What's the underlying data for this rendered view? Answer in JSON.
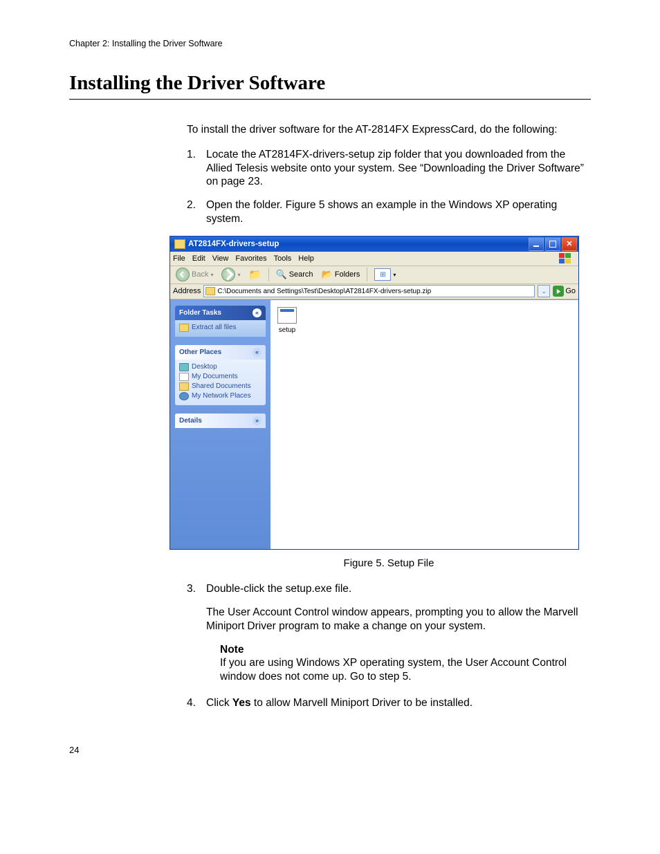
{
  "running_header": "Chapter 2: Installing the Driver Software",
  "heading": "Installing the Driver Software",
  "intro": "To install the driver software for the AT-2814FX ExpressCard, do the following:",
  "steps": {
    "s1_num": "1.",
    "s1": "Locate the AT2814FX-drivers-setup zip folder that you downloaded from the Allied Telesis website onto your system. See “Downloading the Driver Software” on page 23.",
    "s2_num": "2.",
    "s2": "Open the folder. Figure 5 shows an example in the Windows XP operating system.",
    "s3_num": "3.",
    "s3": "Double-click the setup.exe file.",
    "s3_sub": "The User Account Control window appears, prompting you to allow the Marvell Miniport Driver program to make a change on your system.",
    "s4_num": "4.",
    "s4_pre": "Click ",
    "s4_bold": "Yes",
    "s4_post": " to allow Marvell Miniport Driver to be installed."
  },
  "note": {
    "label": "Note",
    "text": "If you are using Windows XP operating system, the User Account Control window does not come up. Go to step 5."
  },
  "figure_caption": "Figure 5. Setup File",
  "page_number": "24",
  "xp": {
    "title": "AT2814FX-drivers-setup",
    "menu": {
      "file": "File",
      "edit": "Edit",
      "view": "View",
      "favorites": "Favorites",
      "tools": "Tools",
      "help": "Help"
    },
    "toolbar": {
      "back": "Back",
      "search": "Search",
      "folders": "Folders"
    },
    "address_label": "Address",
    "address_value": "C:\\Documents and Settings\\Test\\Desktop\\AT2814FX-drivers-setup.zip",
    "go": "Go",
    "sidebar": {
      "folder_tasks": "Folder Tasks",
      "extract": "Extract all files",
      "other_places": "Other Places",
      "desktop": "Desktop",
      "my_documents": "My Documents",
      "shared_documents": "Shared Documents",
      "my_network": "My Network Places",
      "details": "Details"
    },
    "file_name": "setup"
  }
}
